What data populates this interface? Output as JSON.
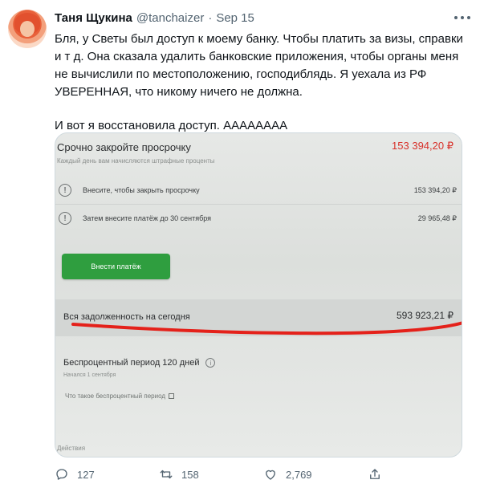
{
  "tweet": {
    "author_name": "Таня Щукина",
    "handle": "@tanchaizer",
    "separator": "·",
    "date": "Sep 15",
    "paragraph1": "Бля, у Светы был доступ к моему банку. Чтобы платить за визы, справки и т д. Она сказала удалить банковские приложения, чтобы органы меня не вычислили по местоположению, господиблядь. Я уехала из РФ УВЕРЕННАЯ, что никому ничего не должна.",
    "paragraph2": "И вот я восстановила доступ. АААААААА"
  },
  "photo": {
    "title": "Срочно закройте просрочку",
    "title_amount": "153 394,20 ₽",
    "subtitle": "Каждый день вам начисляются штрафные проценты",
    "row1_label": "Внесите, чтобы закрыть просрочку",
    "row1_value": "153 394,20 ₽",
    "row2_label": "Затем внесите платёж до 30 сентября",
    "row2_value": "29 965,48 ₽",
    "pay_button": "Внести платёж",
    "total_label": "Вся задолженность на сегодня",
    "total_amount": "593 923,21 ₽",
    "grace_title": "Беспроцентный период 120 дней",
    "grace_sub": "Начался 1 сентября",
    "grace_link": "Что такое беспроцентный период",
    "actions": "Действия",
    "info_glyph": "!",
    "accent_red": "#d8312a",
    "button_green": "#2f9e3f"
  },
  "actions": {
    "reply_count": "127",
    "retweet_count": "158",
    "like_count": "2,769"
  },
  "icons": [
    "more-icon",
    "reply-icon",
    "retweet-icon",
    "like-icon",
    "share-icon",
    "info-icon",
    "external-link-icon"
  ]
}
